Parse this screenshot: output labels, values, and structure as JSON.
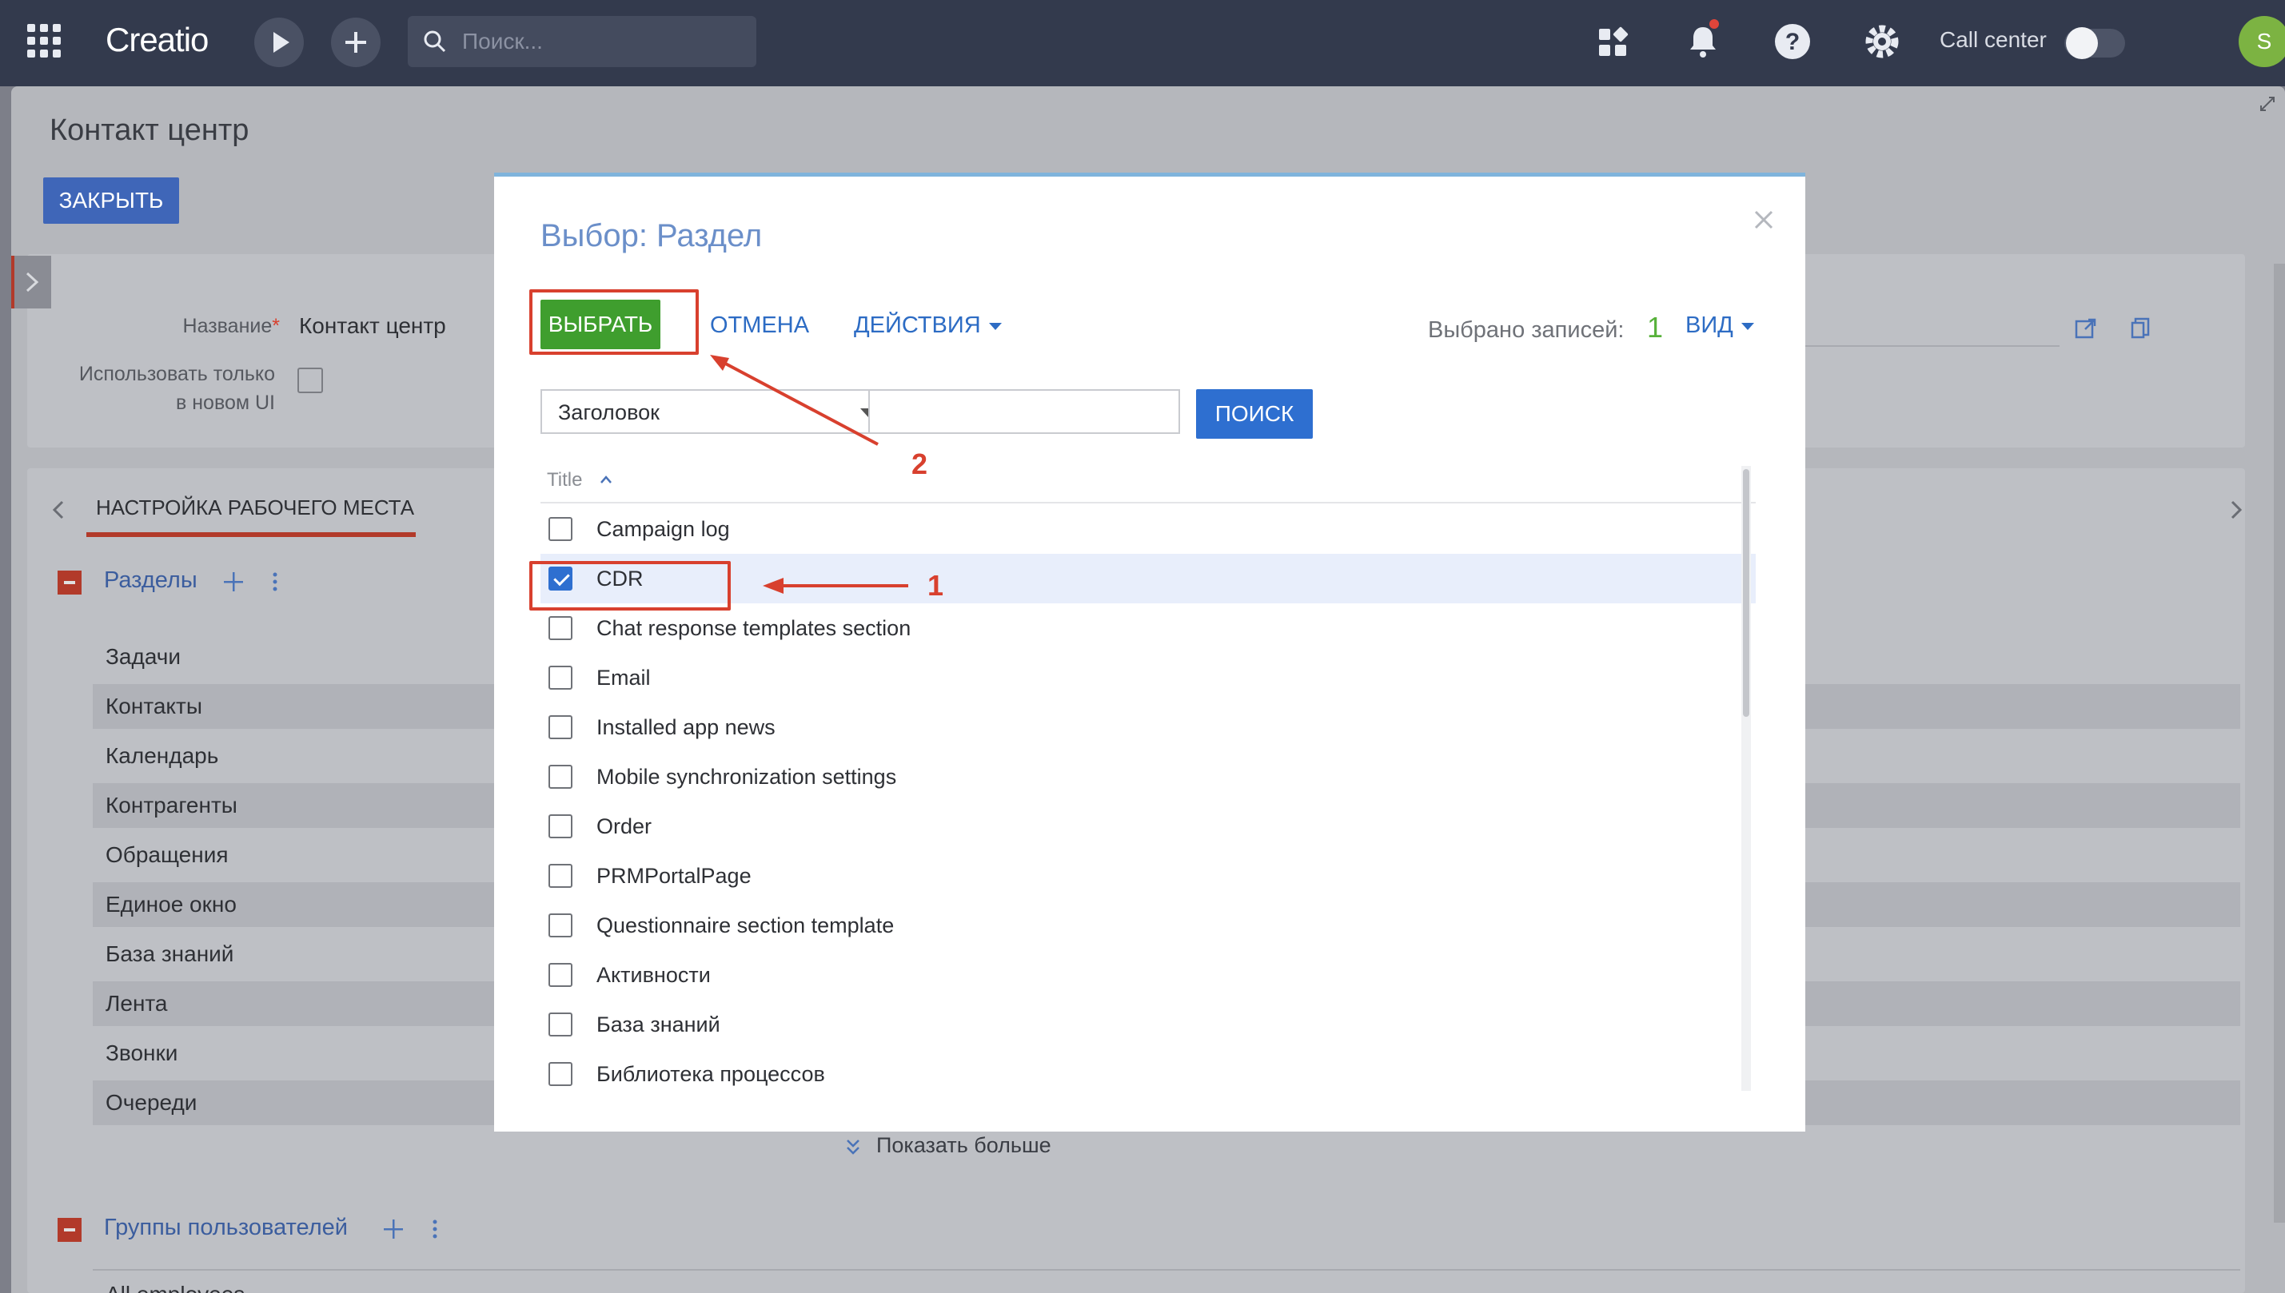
{
  "topbar": {
    "logo": "Creatio",
    "search_placeholder": "Поиск...",
    "call_center_label": "Call center",
    "avatar_initial": "S"
  },
  "page": {
    "title": "Контакт центр",
    "close_button": "ЗАКРЫТЬ",
    "form": {
      "name_label": "Название",
      "name_value": "Контакт центр",
      "use_new_ui_label_1": "Использовать только",
      "use_new_ui_label_2": "в новом UI"
    },
    "tab": "НАСТРОЙКА РАБОЧЕГО МЕСТА",
    "sections_header": "Разделы",
    "sections": [
      "Задачи",
      "Контакты",
      "Календарь",
      "Контрагенты",
      "Обращения",
      "Единое окно",
      "База знаний",
      "Лента",
      "Звонки",
      "Очереди"
    ],
    "show_more": "Показать больше",
    "groups_header": "Группы пользователей",
    "groups_first_item": "All employees"
  },
  "modal": {
    "title": "Выбор: Раздел",
    "select_button": "ВЫБРАТЬ",
    "cancel_link": "ОТМЕНА",
    "actions_link": "ДЕЙСТВИЯ",
    "selected_label": "Выбрано записей:",
    "selected_count": "1",
    "view_link": "ВИД",
    "filter_field": "Заголовок",
    "search_button": "ПОИСК",
    "column_title": "Title",
    "rows": [
      {
        "label": "Campaign log",
        "checked": false
      },
      {
        "label": "CDR",
        "checked": true
      },
      {
        "label": "Chat response templates section",
        "checked": false
      },
      {
        "label": "Email",
        "checked": false
      },
      {
        "label": "Installed app news",
        "checked": false
      },
      {
        "label": "Mobile synchronization settings",
        "checked": false
      },
      {
        "label": "Order",
        "checked": false
      },
      {
        "label": "PRMPortalPage",
        "checked": false
      },
      {
        "label": "Questionnaire section template",
        "checked": false
      },
      {
        "label": "Активности",
        "checked": false
      },
      {
        "label": "База знаний",
        "checked": false
      },
      {
        "label": "Библиотека процессов",
        "checked": false
      }
    ]
  },
  "annotations": {
    "step1": "1",
    "step2": "2"
  },
  "colors": {
    "accent_red": "#d8402e",
    "select_green": "#3f9e2e",
    "link_blue": "#2d6cc4"
  }
}
